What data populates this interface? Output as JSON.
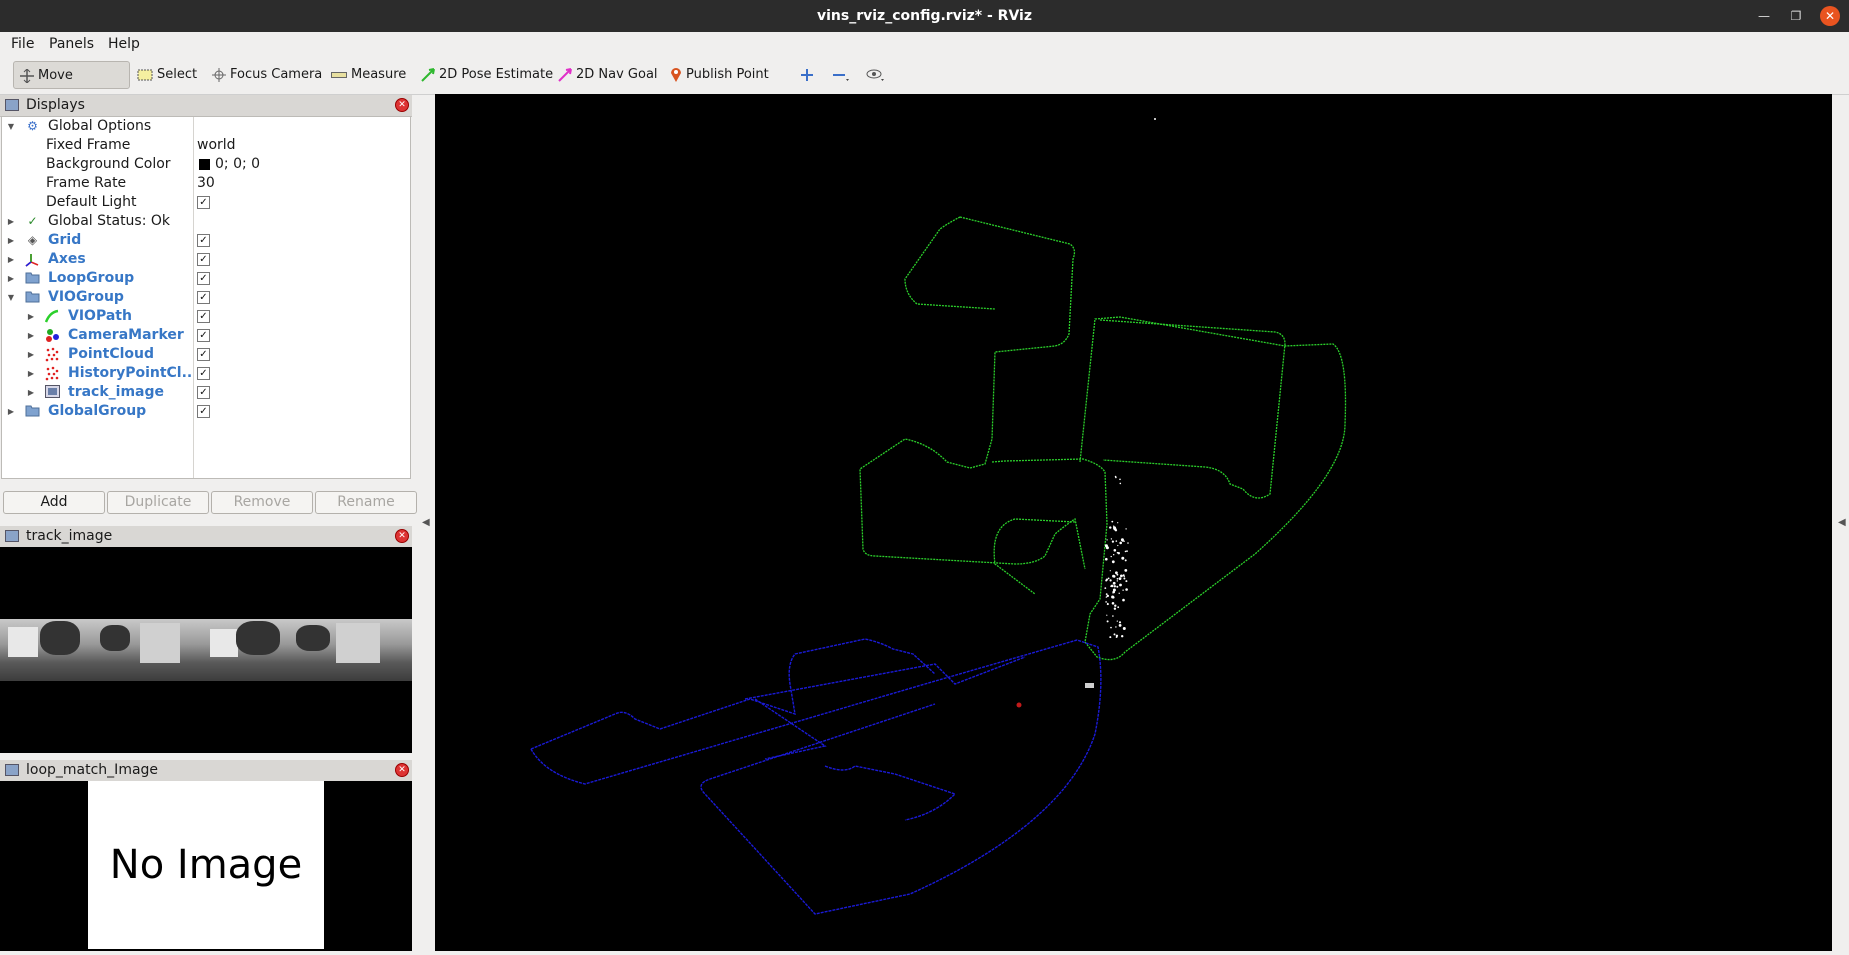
{
  "window": {
    "title": "vins_rviz_config.rviz* - RViz"
  },
  "menu": {
    "file": "File",
    "panels": "Panels",
    "help": "Help"
  },
  "toolbar": {
    "move_camera": "Move Camera",
    "select": "Select",
    "focus_camera": "Focus Camera",
    "measure": "Measure",
    "pose_estimate": "2D Pose Estimate",
    "nav_goal": "2D Nav Goal",
    "publish_point": "Publish Point"
  },
  "displays": {
    "title": "Displays",
    "global_options": "Global Options",
    "fixed_frame_label": "Fixed Frame",
    "fixed_frame_value": "world",
    "bg_color_label": "Background Color",
    "bg_color_value": "0; 0; 0",
    "frame_rate_label": "Frame Rate",
    "frame_rate_value": "30",
    "default_light_label": "Default Light",
    "global_status": "Global Status: Ok",
    "items": {
      "grid": "Grid",
      "axes": "Axes",
      "loop_group": "LoopGroup",
      "vio_group": "VIOGroup",
      "vio_path": "VIOPath",
      "camera_marker": "CameraMarker",
      "point_cloud": "PointCloud",
      "history_point_cloud": "HistoryPointCl...",
      "track_image": "track_image",
      "global_group": "GlobalGroup"
    },
    "buttons": {
      "add": "Add",
      "duplicate": "Duplicate",
      "remove": "Remove",
      "rename": "Rename"
    }
  },
  "track_image_panel": {
    "title": "track_image"
  },
  "loop_panel": {
    "title": "loop_match_Image",
    "placeholder": "No Image"
  },
  "colors": {
    "vio_path": "#2bd02b",
    "global_path": "#1a1ad6",
    "background": "#000000"
  }
}
